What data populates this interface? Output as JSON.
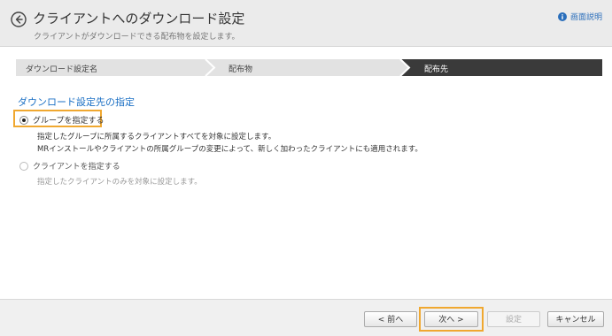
{
  "header": {
    "title": "クライアントへのダウンロード設定",
    "subtitle": "クライアントがダウンロードできる配布物を設定します。",
    "help_label": "画面説明",
    "back_icon": "arrow-left-circle-icon",
    "help_icon": "info-icon"
  },
  "steps": [
    {
      "label": "ダウンロード設定名",
      "state": "done"
    },
    {
      "label": "配布物",
      "state": "done"
    },
    {
      "label": "配布先",
      "state": "active"
    }
  ],
  "section": {
    "title": "ダウンロード設定先の指定"
  },
  "options": [
    {
      "label": "グループを指定する",
      "checked": true,
      "desc_lines": [
        "指定したグループに所属するクライアントすべてを対象に設定します。",
        "MRインストールやクライアントの所属グループの変更によって、新しく加わったクライアントにも適用されます。"
      ]
    },
    {
      "label": "クライアントを指定する",
      "checked": false,
      "desc_lines": [
        "指定したクライアントのみを対象に設定します。"
      ]
    }
  ],
  "footer": {
    "prev_label": "< 前へ",
    "next_label": "次へ >",
    "set_label": "設定",
    "cancel_label": "キャンセル"
  },
  "colors": {
    "accent": "#1a6fc4",
    "highlight": "#f0a830",
    "step_active": "#3a3a3a",
    "step_done": "#e2e2e2"
  }
}
